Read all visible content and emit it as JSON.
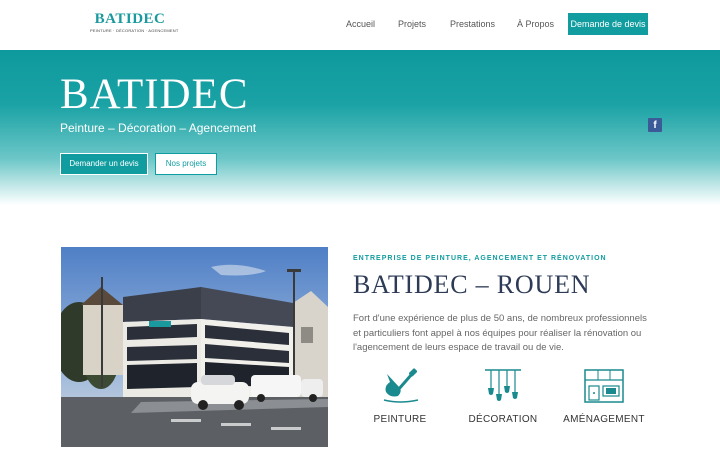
{
  "header": {
    "logo_title": "BATIDEC",
    "logo_subtitle": "PEINTURE · DÉCORATION · AGENCEMENT",
    "nav": [
      "Accueil",
      "Projets",
      "Prestations",
      "À Propos"
    ],
    "cta": "Demande de devis"
  },
  "hero": {
    "title": "BATIDEC",
    "subtitle": "Peinture – Décoration – Agencement",
    "primary_button": "Demander un devis",
    "secondary_button": "Nos projets",
    "social_icon": "facebook-icon"
  },
  "about": {
    "eyebrow": "ENTREPRISE DE PEINTURE, AGENCEMENT ET RÉNOVATION",
    "title": "BATIDEC – ROUEN",
    "text": "Fort d'une expérience de plus de 50 ans, de nombreux professionnels et particuliers font appel à nos équipes pour réaliser la rénovation ou l'agencement de leurs espace de travail ou de vie.",
    "photo_icon": "building-photo",
    "services": [
      {
        "label": "PEINTURE",
        "icon": "paint-trowel-icon"
      },
      {
        "label": "DÉCORATION",
        "icon": "pendant-lights-icon"
      },
      {
        "label": "AMÉNAGEMENT",
        "icon": "kitchen-icon"
      }
    ]
  },
  "colors": {
    "accent": "#119da0",
    "title": "#2e3b57",
    "facebook": "#3b5b98"
  }
}
